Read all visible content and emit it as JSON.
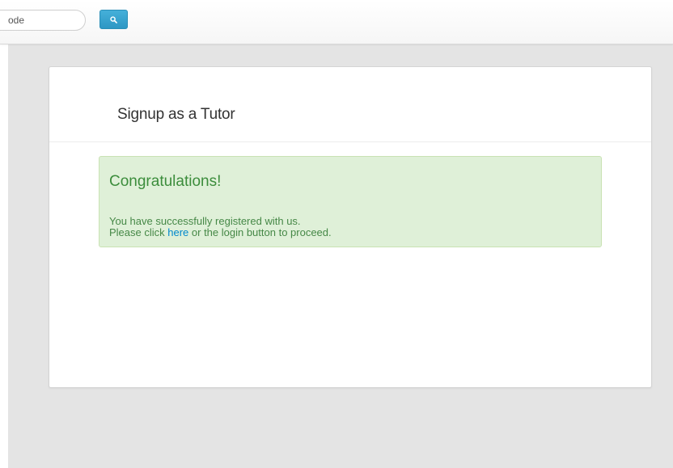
{
  "search": {
    "placeholder": "ode",
    "button_icon": "search-icon"
  },
  "card": {
    "title": "Signup as a Tutor"
  },
  "alert": {
    "heading": "Congratulations!",
    "line1": "You have successfully registered with us.",
    "line2_before": "Please click ",
    "link_label": "here",
    "line2_after": " or the login button to proceed."
  },
  "colors": {
    "page_background": "#e4e4e4",
    "accent_button": "#2d97c4",
    "success_background": "#dff0d8",
    "success_text": "#468847",
    "link": "#0088cc"
  }
}
